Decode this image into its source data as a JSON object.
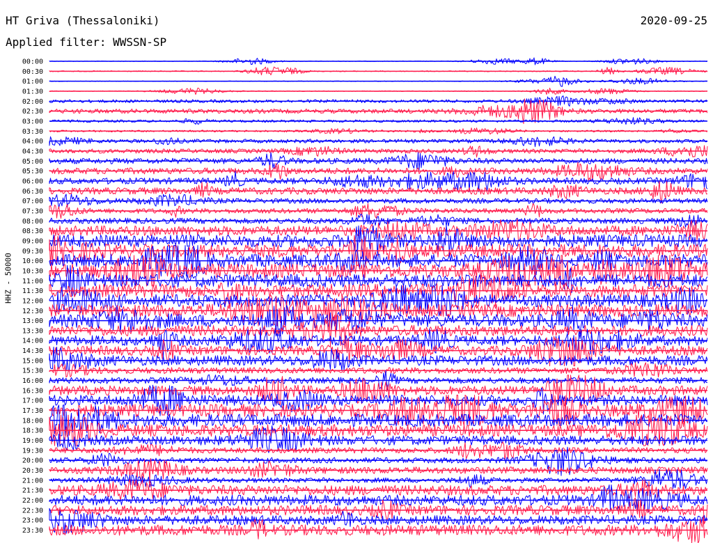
{
  "header": {
    "station": "HT Griva (Thessaloniki)",
    "date": "2020-09-25",
    "filter": "Applied filter: WWSSN-SP"
  },
  "chart_data": {
    "type": "line",
    "ylabel": "HHZ - 50000",
    "colors": [
      "#0000ff",
      "#ff1a4b"
    ],
    "traces": [
      {
        "time": "00:00",
        "color": "#0000ff",
        "amp": 0.05
      },
      {
        "time": "00:30",
        "color": "#ff1a4b",
        "amp": 0.08
      },
      {
        "time": "01:00",
        "color": "#0000ff",
        "amp": 0.05
      },
      {
        "time": "01:30",
        "color": "#ff1a4b",
        "amp": 0.06
      },
      {
        "time": "02:00",
        "color": "#0000ff",
        "amp": 0.25
      },
      {
        "time": "02:30",
        "color": "#ff1a4b",
        "amp": 0.35
      },
      {
        "time": "03:00",
        "color": "#0000ff",
        "amp": 0.2
      },
      {
        "time": "03:30",
        "color": "#ff1a4b",
        "amp": 0.15
      },
      {
        "time": "04:00",
        "color": "#0000ff",
        "amp": 0.3
      },
      {
        "time": "04:30",
        "color": "#ff1a4b",
        "amp": 0.35
      },
      {
        "time": "05:00",
        "color": "#0000ff",
        "amp": 0.45
      },
      {
        "time": "05:30",
        "color": "#ff1a4b",
        "amp": 0.5
      },
      {
        "time": "06:00",
        "color": "#0000ff",
        "amp": 0.5
      },
      {
        "time": "06:30",
        "color": "#ff1a4b",
        "amp": 0.55
      },
      {
        "time": "07:00",
        "color": "#0000ff",
        "amp": 0.4
      },
      {
        "time": "07:30",
        "color": "#ff1a4b",
        "amp": 0.4
      },
      {
        "time": "08:00",
        "color": "#0000ff",
        "amp": 0.45
      },
      {
        "time": "08:30",
        "color": "#ff1a4b",
        "amp": 0.8
      },
      {
        "time": "09:00",
        "color": "#0000ff",
        "amp": 1.0
      },
      {
        "time": "09:30",
        "color": "#ff1a4b",
        "amp": 1.05
      },
      {
        "time": "10:00",
        "color": "#0000ff",
        "amp": 1.05
      },
      {
        "time": "10:30",
        "color": "#ff1a4b",
        "amp": 1.1
      },
      {
        "time": "11:00",
        "color": "#0000ff",
        "amp": 1.05
      },
      {
        "time": "11:30",
        "color": "#ff1a4b",
        "amp": 1.05
      },
      {
        "time": "12:00",
        "color": "#0000ff",
        "amp": 1.0
      },
      {
        "time": "12:30",
        "color": "#ff1a4b",
        "amp": 1.0
      },
      {
        "time": "13:00",
        "color": "#0000ff",
        "amp": 1.0
      },
      {
        "time": "13:30",
        "color": "#ff1a4b",
        "amp": 0.85
      },
      {
        "time": "14:00",
        "color": "#0000ff",
        "amp": 0.8
      },
      {
        "time": "14:30",
        "color": "#ff1a4b",
        "amp": 0.75
      },
      {
        "time": "15:00",
        "color": "#0000ff",
        "amp": 0.8
      },
      {
        "time": "15:30",
        "color": "#ff1a4b",
        "amp": 0.5
      },
      {
        "time": "16:00",
        "color": "#0000ff",
        "amp": 0.5
      },
      {
        "time": "16:30",
        "color": "#ff1a4b",
        "amp": 0.75
      },
      {
        "time": "17:00",
        "color": "#0000ff",
        "amp": 0.85
      },
      {
        "time": "17:30",
        "color": "#ff1a4b",
        "amp": 1.0
      },
      {
        "time": "18:00",
        "color": "#0000ff",
        "amp": 1.0
      },
      {
        "time": "18:30",
        "color": "#ff1a4b",
        "amp": 0.95
      },
      {
        "time": "19:00",
        "color": "#0000ff",
        "amp": 0.75
      },
      {
        "time": "19:30",
        "color": "#ff1a4b",
        "amp": 0.45
      },
      {
        "time": "20:00",
        "color": "#0000ff",
        "amp": 0.45
      },
      {
        "time": "20:30",
        "color": "#ff1a4b",
        "amp": 0.55
      },
      {
        "time": "21:00",
        "color": "#0000ff",
        "amp": 0.4
      },
      {
        "time": "21:30",
        "color": "#ff1a4b",
        "amp": 0.8
      },
      {
        "time": "22:00",
        "color": "#0000ff",
        "amp": 0.85
      },
      {
        "time": "22:30",
        "color": "#ff1a4b",
        "amp": 0.8
      },
      {
        "time": "23:00",
        "color": "#0000ff",
        "amp": 0.75
      },
      {
        "time": "23:30",
        "color": "#ff1a4b",
        "amp": 0.85
      }
    ]
  }
}
